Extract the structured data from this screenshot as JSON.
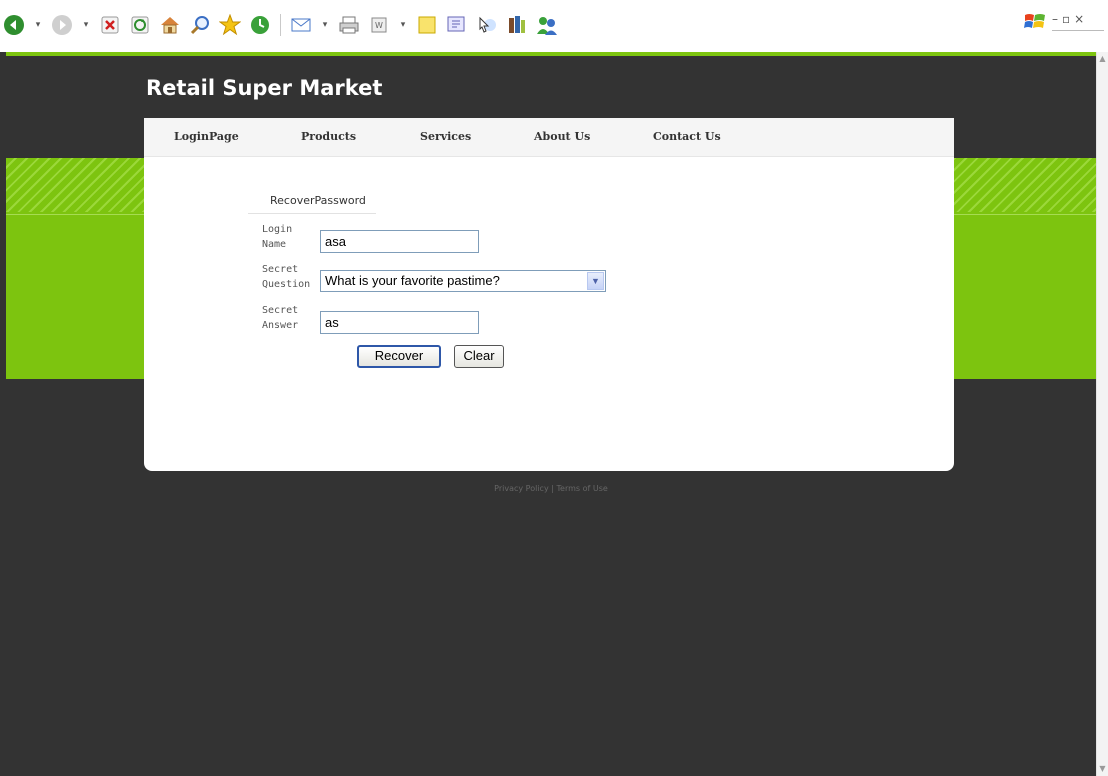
{
  "browser": {
    "toolbar_icons": [
      "back-icon",
      "forward-icon",
      "stop-icon",
      "refresh-icon",
      "home-icon",
      "search-icon",
      "favorites-icon",
      "history-icon",
      "mail-icon",
      "print-icon",
      "edit-icon",
      "notes-icon",
      "messenger-icon",
      "research-icon",
      "media-icon",
      "messenger-people-icon"
    ]
  },
  "site": {
    "title": "Retail Super Market"
  },
  "nav": {
    "items": [
      "LoginPage",
      "Products",
      "Services",
      "About Us",
      "Contact Us"
    ]
  },
  "form": {
    "heading": "RecoverPassword",
    "login_name": {
      "label_line1": "Login",
      "label_line2": "Name",
      "value": "asa"
    },
    "secret_question": {
      "label_line1": "Secret",
      "label_line2": "Question",
      "selected": "What is your favorite pastime?"
    },
    "secret_answer": {
      "label_line1": "Secret",
      "label_line2": "Answer",
      "value": "as"
    },
    "recover_label": "Recover",
    "clear_label": "Clear"
  },
  "footer": {
    "privacy": "Privacy Policy",
    "separator": "|",
    "terms": "Terms of Use"
  },
  "colors": {
    "accent_green": "#7dc40f",
    "page_dark": "#333333"
  }
}
